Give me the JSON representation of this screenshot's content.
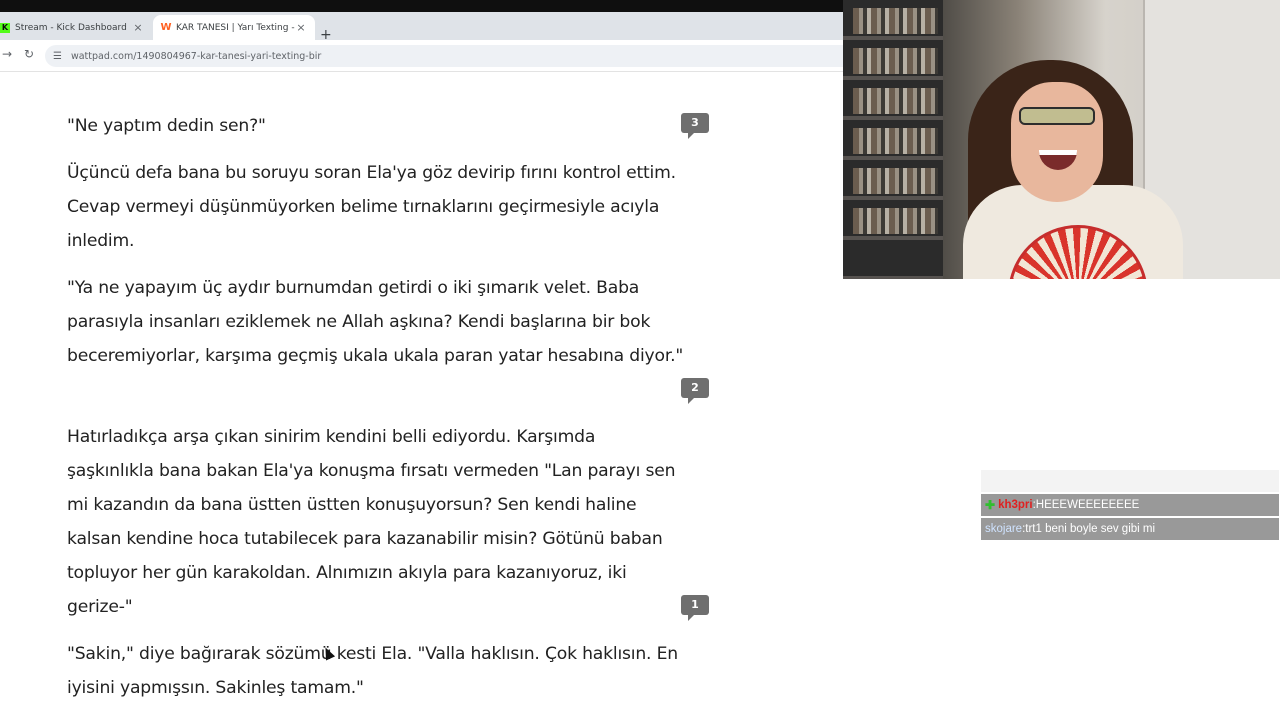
{
  "browser": {
    "tabs": [
      {
        "title": "Stream - Kick Dashboard",
        "icon": "kick-icon",
        "icon_glyph": "K"
      },
      {
        "title": "KAR TANESİ | Yarı Texting - bir",
        "icon": "wattpad-icon",
        "icon_glyph": "W",
        "active": true
      }
    ],
    "tab_close_glyph": "×",
    "new_tab_glyph": "+",
    "back_glyph": "→",
    "reload_glyph": "↻",
    "site_info_glyph": "☰",
    "url": "wattpad.com/1490804967-kar-tanesi-yari-texting-bir"
  },
  "story": {
    "paragraphs": [
      {
        "text": "\"Ne yaptım dedin sen?\"",
        "comments": "3"
      },
      {
        "text": "Üçüncü defa bana bu soruyu soran Ela'ya göz devirip fırını kontrol ettim. Cevap vermeyi düşünmüyorken belime tırnaklarını geçirmesiyle acıyla inledim.",
        "comments": ""
      },
      {
        "text": "\"Ya ne yapayım üç aydır burnumdan getirdi o iki şımarık velet. Baba parasıyla insanları eziklemek ne Allah aşkına? Kendi başlarına bir bok beceremiyorlar, karşıma geçmiş ukala ukala paran yatar hesabına diyor.\"",
        "comments": "2"
      },
      {
        "text": "Hatırladıkça arşa çıkan sinirim kendini belli ediyordu. Karşımda şaşkınlıkla bana bakan Ela'ya konuşma fırsatı vermeden \"Lan parayı sen mi kazandın da bana üstten üstten konuşuyorsun? Sen kendi haline kalsan kendine hoca tutabilecek para kazanabilir misin? Götünü baban topluyor her gün karakoldan. Alnımızın akıyla para kazanıyoruz, iki gerize-\"",
        "comments": "1"
      },
      {
        "text": "\"Sakin,\" diye bağırarak sözümü kesti Ela. \"Valla haklısın. Çok haklısın. En iyisini yapmışsın. Sakinleş tamam.\"",
        "comments": ""
      }
    ]
  },
  "chat": {
    "messages": [
      {
        "badge_icon": "kick-badge-icon",
        "badge_glyph": "✚",
        "user": "kh3pri",
        "separator": " : ",
        "text": "HEEEWEEEEEEEE"
      },
      {
        "badge_icon": "",
        "badge_glyph": "",
        "user": "skojare",
        "separator": " : ",
        "text": "trt1 beni boyle sev gibi mi"
      }
    ]
  },
  "colors": {
    "kick_green": "#53fc18",
    "wattpad_orange": "#ff6122",
    "comment_badge": "#6f6f6f"
  }
}
